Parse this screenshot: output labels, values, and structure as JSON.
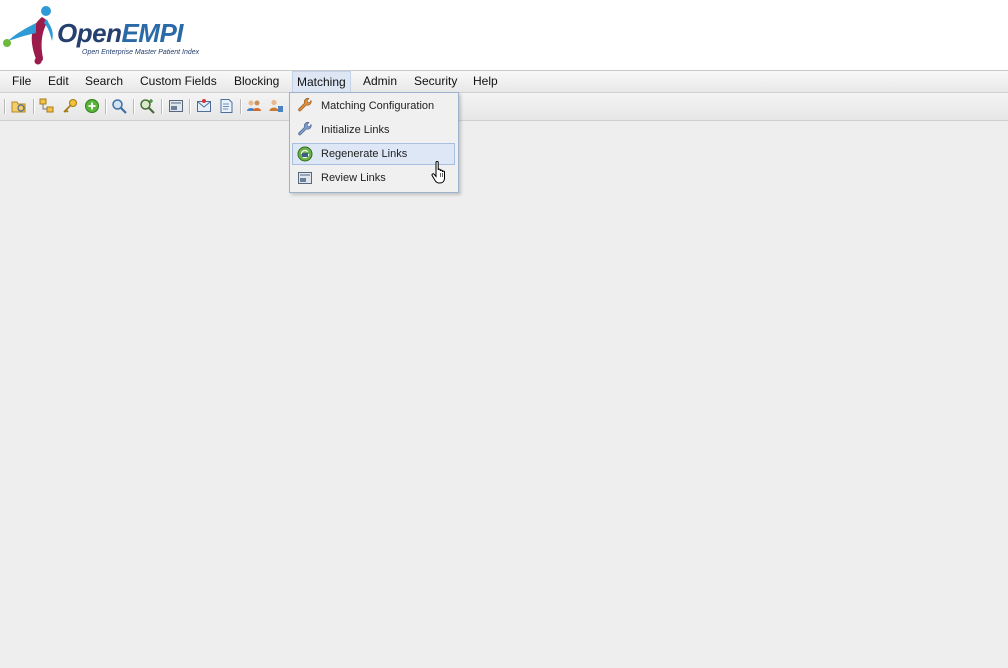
{
  "logo": {
    "name_part1": "Open",
    "name_part2": "EMPI",
    "tagline": "Open Enterprise Master Patient Index"
  },
  "menubar": {
    "items": [
      {
        "label": "File"
      },
      {
        "label": "Edit"
      },
      {
        "label": "Search"
      },
      {
        "label": "Custom Fields"
      },
      {
        "label": "Blocking"
      },
      {
        "label": "Matching"
      },
      {
        "label": "Admin"
      },
      {
        "label": "Security"
      },
      {
        "label": "Help"
      }
    ],
    "active": "Matching"
  },
  "toolbar": {
    "buttons": [
      "open-folder-icon",
      "tree-nodes-icon",
      "key-icon",
      "add-icon",
      "search-icon",
      "advanced-search-icon",
      "record-icon",
      "envelope-icon",
      "document-icon",
      "users-icon",
      "user-link-icon"
    ]
  },
  "matching_menu": {
    "items": [
      {
        "label": "Matching Configuration",
        "icon": "wrench-orange-icon"
      },
      {
        "label": "Initialize Links",
        "icon": "wrench-blue-icon"
      },
      {
        "label": "Regenerate Links",
        "icon": "regenerate-globe-icon"
      },
      {
        "label": "Review Links",
        "icon": "review-record-icon"
      }
    ],
    "hovered": "Regenerate Links"
  },
  "colors": {
    "brand_navy": "#25406e",
    "menu_highlight": "#dde7f6",
    "menu_border": "#9fb2cc",
    "background": "#eeeeee"
  }
}
